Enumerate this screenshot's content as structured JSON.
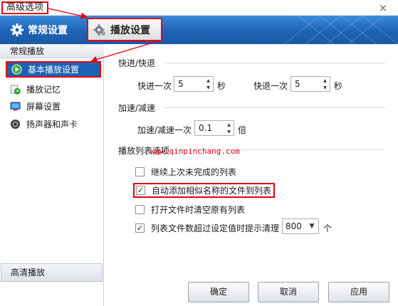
{
  "window": {
    "title": "高级选项",
    "close_glyph": "×"
  },
  "tabs": [
    {
      "label": "常规设置",
      "icon": "gear-icon",
      "active": false
    },
    {
      "label": "播放设置",
      "icon": "gear-icon",
      "active": true
    }
  ],
  "sidebar": {
    "header": "常规播放",
    "items": [
      {
        "label": "基本播放设置",
        "icon": "play-circle-icon",
        "selected": true
      },
      {
        "label": "播放记忆",
        "icon": "clock-icon",
        "selected": false
      },
      {
        "label": "屏幕设置",
        "icon": "monitor-icon",
        "selected": false
      },
      {
        "label": "扬声器和声卡",
        "icon": "speaker-icon",
        "selected": false
      }
    ],
    "bottom_section": "高清播放"
  },
  "seek": {
    "section_title": "快进/快退",
    "forward_label": "快进一次",
    "forward_value": "5",
    "forward_unit": "秒",
    "backward_label": "快退一次",
    "backward_value": "5",
    "backward_unit": "秒"
  },
  "speed": {
    "section_title": "加速/减速",
    "label": "加速/减速一次",
    "value": "0.1",
    "unit": "倍"
  },
  "playlist": {
    "section_title": "播放列表选项",
    "options": [
      {
        "label": "继续上次未完成的列表",
        "checked": false
      },
      {
        "label": "自动添加相似名称的文件到列表",
        "checked": true
      },
      {
        "label": "打开文件时清空原有列表",
        "checked": false
      },
      {
        "label": "列表文件数超过设定值时提示清理",
        "checked": true
      }
    ],
    "threshold_value": "800",
    "threshold_unit": "个"
  },
  "watermark": "www.qinpinchang.com",
  "buttons": {
    "ok": "确定",
    "cancel": "取消",
    "apply": "应用"
  },
  "colors": {
    "accent_blue": "#1d63b4",
    "highlight_red": "#e60012"
  }
}
